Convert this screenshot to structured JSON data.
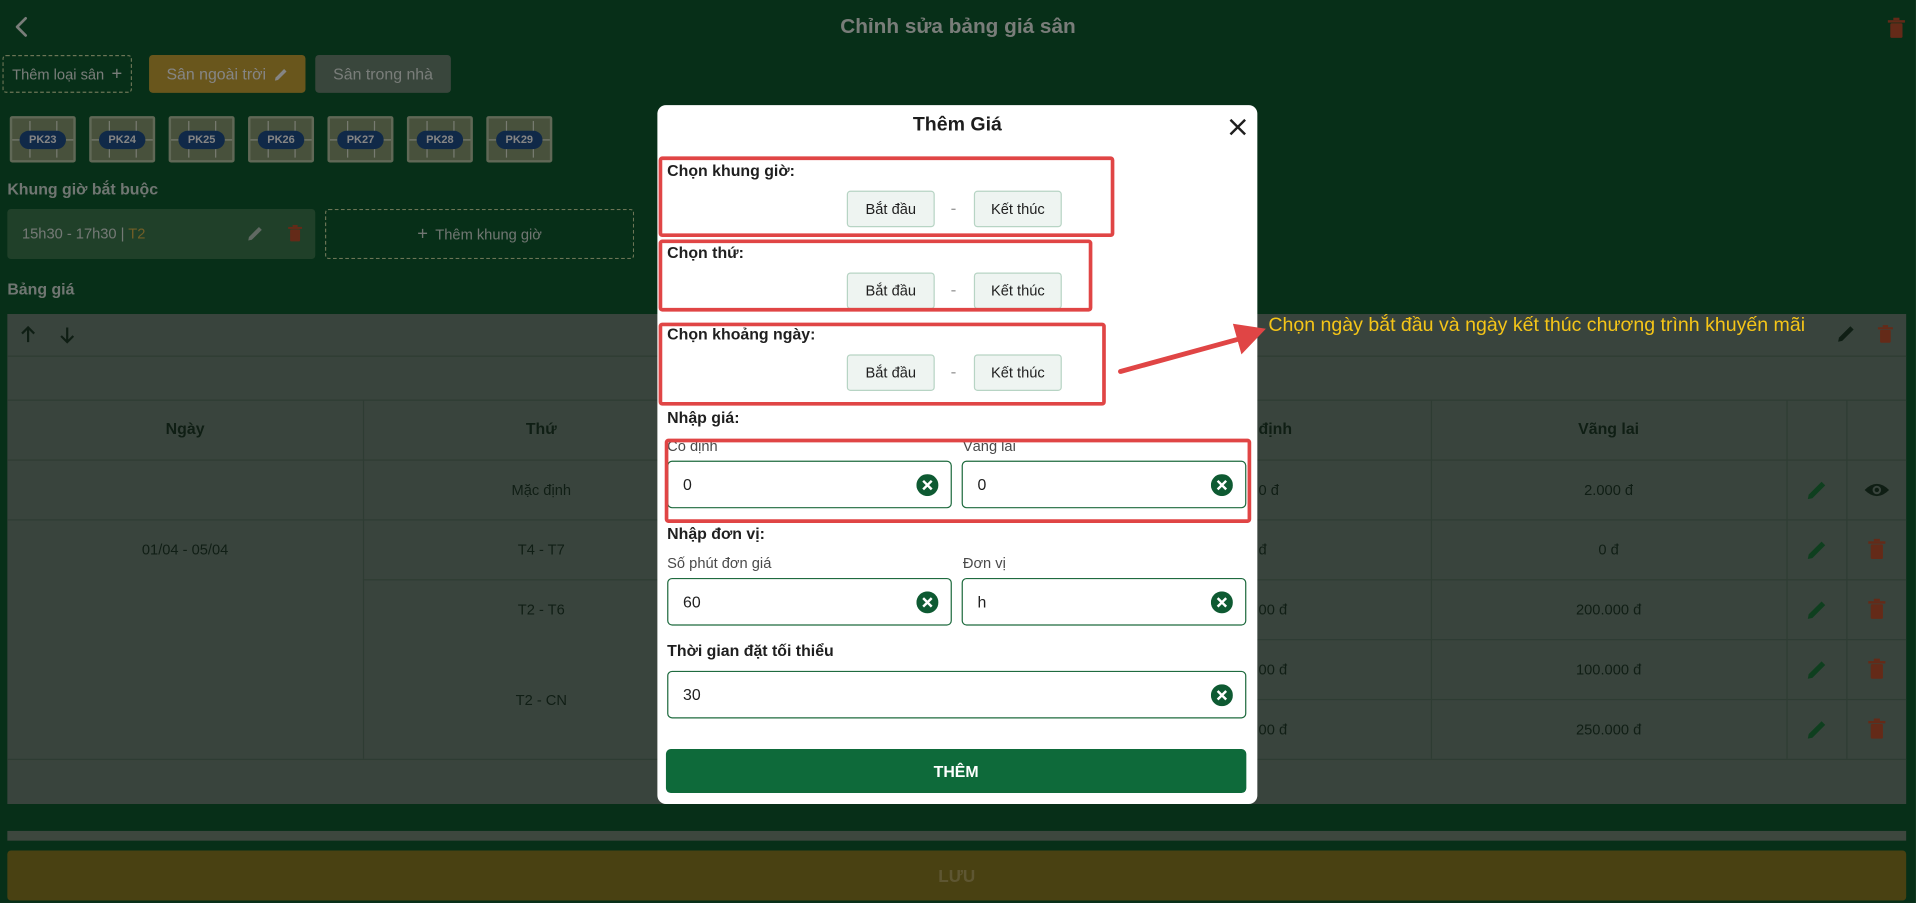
{
  "header": {
    "title": "Chỉnh sửa bảng giá sân"
  },
  "toolbar": {
    "add_type_label": "Thêm loại sân",
    "outdoor_label": "Sân ngoài trời",
    "indoor_label": "Sân trong nhà"
  },
  "courts": [
    "PK23",
    "PK24",
    "PK25",
    "PK26",
    "PK27",
    "PK28",
    "PK29"
  ],
  "required_slots": {
    "title": "Khung giờ bắt buộc",
    "slot_time": "15h30 - 17h30",
    "slot_sep": " | ",
    "slot_day": "T2",
    "add_label": "Thêm khung giờ"
  },
  "price_table": {
    "title": "Bảng giá",
    "headers": {
      "date": "Ngày",
      "weekday": "Thứ",
      "fixed": "định",
      "walkin": "Vãng lai"
    },
    "rows": [
      {
        "date": "",
        "weekday": "Mặc định",
        "fixed": "0 đ",
        "walkin": "2.000 đ"
      },
      {
        "date": "01/04 - 05/04",
        "weekday": "T4 - T7",
        "fixed": "đ",
        "walkin": "0 đ"
      },
      {
        "date": "",
        "weekday": "T2 - T6",
        "fixed": "00 đ",
        "walkin": "200.000 đ"
      },
      {
        "date": "",
        "weekday": "T2 - CN",
        "fixed": "00 đ",
        "walkin": "100.000 đ"
      },
      {
        "date": "",
        "weekday": "",
        "fixed": "00 đ",
        "walkin": "250.000 đ"
      }
    ]
  },
  "save_label": "LƯU",
  "modal": {
    "title": "Thêm Giá",
    "time_frame": {
      "label": "Chọn khung giờ:",
      "start": "Bắt đầu",
      "end": "Kết thúc"
    },
    "weekday": {
      "label": "Chọn thứ:",
      "start": "Bắt đầu",
      "end": "Kết thúc"
    },
    "date_range": {
      "label": "Chọn khoảng ngày:",
      "start": "Bắt đầu",
      "end": "Kết thúc"
    },
    "dash": "-",
    "price": {
      "label": "Nhập giá:",
      "fixed_label": "Cố định",
      "fixed_value": "0",
      "walkin_label": "Vãng lai",
      "walkin_value": "0"
    },
    "unit": {
      "label": "Nhập đơn vị:",
      "minutes_label": "Số phút đơn giá",
      "minutes_value": "60",
      "unit_label": "Đơn vị",
      "unit_value": "h"
    },
    "min_time": {
      "label": "Thời gian đặt tối thiểu",
      "value": "30"
    },
    "submit_label": "THÊM"
  },
  "annotation": {
    "text": "Chọn ngày bắt đầu và ngày kết thúc chương trình khuyến mãi",
    "color": "#f5c518",
    "box_color": "#e04545"
  },
  "colors": {
    "background": "#0f5a2e",
    "primary": "#0e6a3a",
    "accent": "#c9a637",
    "danger": "#e04545"
  }
}
